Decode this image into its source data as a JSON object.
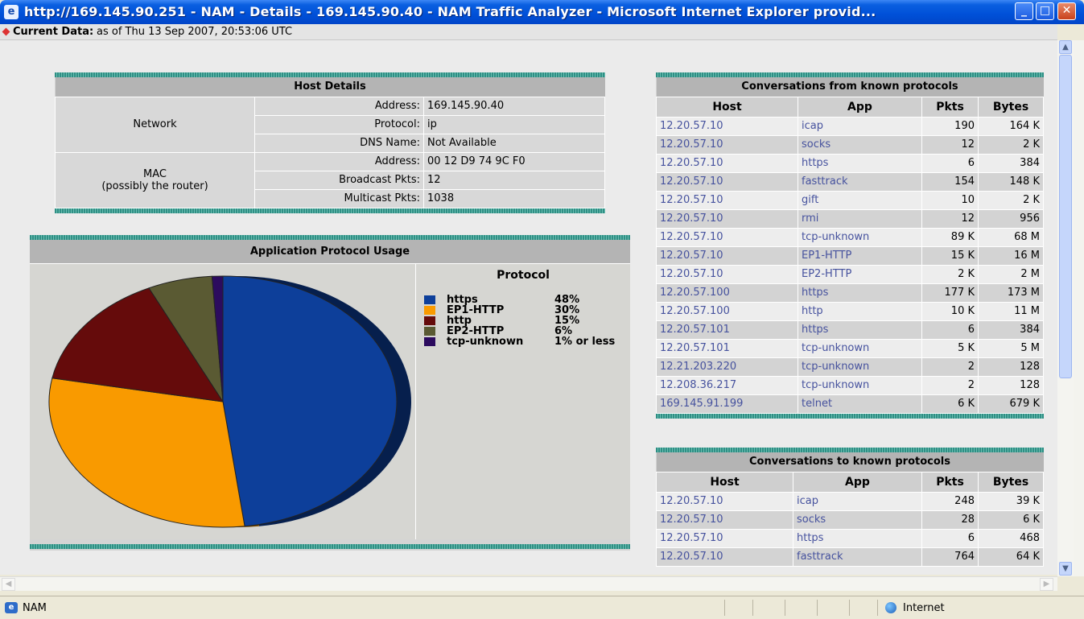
{
  "window": {
    "title": "http://169.145.90.251 - NAM - Details - 169.145.90.40 - NAM Traffic Analyzer - Microsoft Internet Explorer provid...",
    "minimize": "_",
    "maximize": "□",
    "close": "✕"
  },
  "infobar": {
    "label": "Current Data:",
    "value": "as of Thu 13 Sep 2007, 20:53:06 UTC"
  },
  "host_details": {
    "title": "Host Details",
    "network_label": "Network",
    "mac_label": "MAC",
    "mac_sublabel": "(possibly the router)",
    "rows": [
      {
        "key": "Address:",
        "value": "169.145.90.40"
      },
      {
        "key": "Protocol:",
        "value": "ip"
      },
      {
        "key": "DNS Name:",
        "value": "Not Available"
      },
      {
        "key": "Address:",
        "value": "00 12 D9 74 9C F0"
      },
      {
        "key": "Broadcast Pkts:",
        "value": "12"
      },
      {
        "key": "Multicast Pkts:",
        "value": "1038"
      }
    ]
  },
  "chart_data": {
    "type": "pie",
    "title": "Application Protocol Usage",
    "legend_title": "Protocol",
    "legend_position": "right",
    "slices": [
      {
        "label": "https",
        "value": 48,
        "display": "48%",
        "color": "#0d3f9a"
      },
      {
        "label": "EP1-HTTP",
        "value": 30,
        "display": "30%",
        "color": "#f99a00"
      },
      {
        "label": "http",
        "value": 15,
        "display": "15%",
        "color": "#650b0b"
      },
      {
        "label": "EP2-HTTP",
        "value": 6,
        "display": "6%",
        "color": "#5a5a33"
      },
      {
        "label": "tcp-unknown",
        "value": 1,
        "display": "1% or less",
        "color": "#2c0b5e"
      }
    ]
  },
  "conv_from": {
    "title": "Conversations from known protocols",
    "columns": [
      "Host",
      "App",
      "Pkts",
      "Bytes"
    ],
    "rows": [
      [
        "12.20.57.10",
        "icap",
        "190",
        "164 K"
      ],
      [
        "12.20.57.10",
        "socks",
        "12",
        "2 K"
      ],
      [
        "12.20.57.10",
        "https",
        "6",
        "384"
      ],
      [
        "12.20.57.10",
        "fasttrack",
        "154",
        "148 K"
      ],
      [
        "12.20.57.10",
        "gift",
        "10",
        "2 K"
      ],
      [
        "12.20.57.10",
        "rmi",
        "12",
        "956"
      ],
      [
        "12.20.57.10",
        "tcp-unknown",
        "89 K",
        "68 M"
      ],
      [
        "12.20.57.10",
        "EP1-HTTP",
        "15 K",
        "16 M"
      ],
      [
        "12.20.57.10",
        "EP2-HTTP",
        "2 K",
        "2 M"
      ],
      [
        "12.20.57.100",
        "https",
        "177 K",
        "173 M"
      ],
      [
        "12.20.57.100",
        "http",
        "10 K",
        "11 M"
      ],
      [
        "12.20.57.101",
        "https",
        "6",
        "384"
      ],
      [
        "12.20.57.101",
        "tcp-unknown",
        "5 K",
        "5 M"
      ],
      [
        "12.21.203.220",
        "tcp-unknown",
        "2",
        "128"
      ],
      [
        "12.208.36.217",
        "tcp-unknown",
        "2",
        "128"
      ],
      [
        "169.145.91.199",
        "telnet",
        "6 K",
        "679 K"
      ]
    ]
  },
  "conv_to": {
    "title": "Conversations to known protocols",
    "columns": [
      "Host",
      "App",
      "Pkts",
      "Bytes"
    ],
    "rows": [
      [
        "12.20.57.10",
        "icap",
        "248",
        "39 K"
      ],
      [
        "12.20.57.10",
        "socks",
        "28",
        "6 K"
      ],
      [
        "12.20.57.10",
        "https",
        "6",
        "468"
      ],
      [
        "12.20.57.10",
        "fasttrack",
        "764",
        "64 K"
      ]
    ]
  },
  "statusbar": {
    "text": "NAM",
    "zone": "Internet"
  },
  "icons": {
    "ie": "ie-icon",
    "globe": "internet-zone-icon",
    "scroll_up": "▲",
    "scroll_down": "▼",
    "scroll_left": "◀",
    "scroll_right": "▶"
  }
}
